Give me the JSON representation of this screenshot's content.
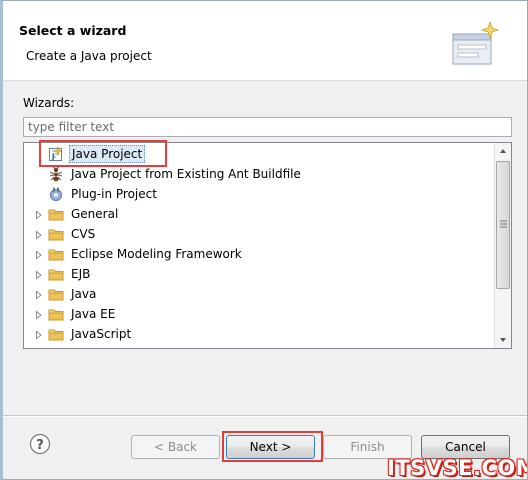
{
  "header": {
    "title": "Select a wizard",
    "description": "Create a Java project"
  },
  "wizards": {
    "label": "Wizards:",
    "filter_placeholder": "type filter text",
    "items": [
      {
        "label": "Java Project",
        "icon": "java-project-icon",
        "expandable": false,
        "selected": true
      },
      {
        "label": "Java Project from Existing Ant Buildfile",
        "icon": "ant-icon",
        "expandable": false,
        "selected": false
      },
      {
        "label": "Plug-in Project",
        "icon": "plugin-icon",
        "expandable": false,
        "selected": false
      },
      {
        "label": "General",
        "icon": "folder-icon",
        "expandable": true,
        "selected": false
      },
      {
        "label": "CVS",
        "icon": "folder-icon",
        "expandable": true,
        "selected": false
      },
      {
        "label": "Eclipse Modeling Framework",
        "icon": "folder-icon",
        "expandable": true,
        "selected": false
      },
      {
        "label": "EJB",
        "icon": "folder-icon",
        "expandable": true,
        "selected": false
      },
      {
        "label": "Java",
        "icon": "folder-icon",
        "expandable": true,
        "selected": false
      },
      {
        "label": "Java EE",
        "icon": "folder-icon",
        "expandable": true,
        "selected": false
      },
      {
        "label": "JavaScript",
        "icon": "folder-icon",
        "expandable": true,
        "selected": false
      }
    ]
  },
  "buttons": {
    "back": "< Back",
    "next": "Next >",
    "finish": "Finish",
    "cancel": "Cancel"
  },
  "watermark": "ITSVSE.COM",
  "colors": {
    "highlight_box": "#e23d3d",
    "folder": "#e8c255",
    "watermark": "#e0261c"
  }
}
